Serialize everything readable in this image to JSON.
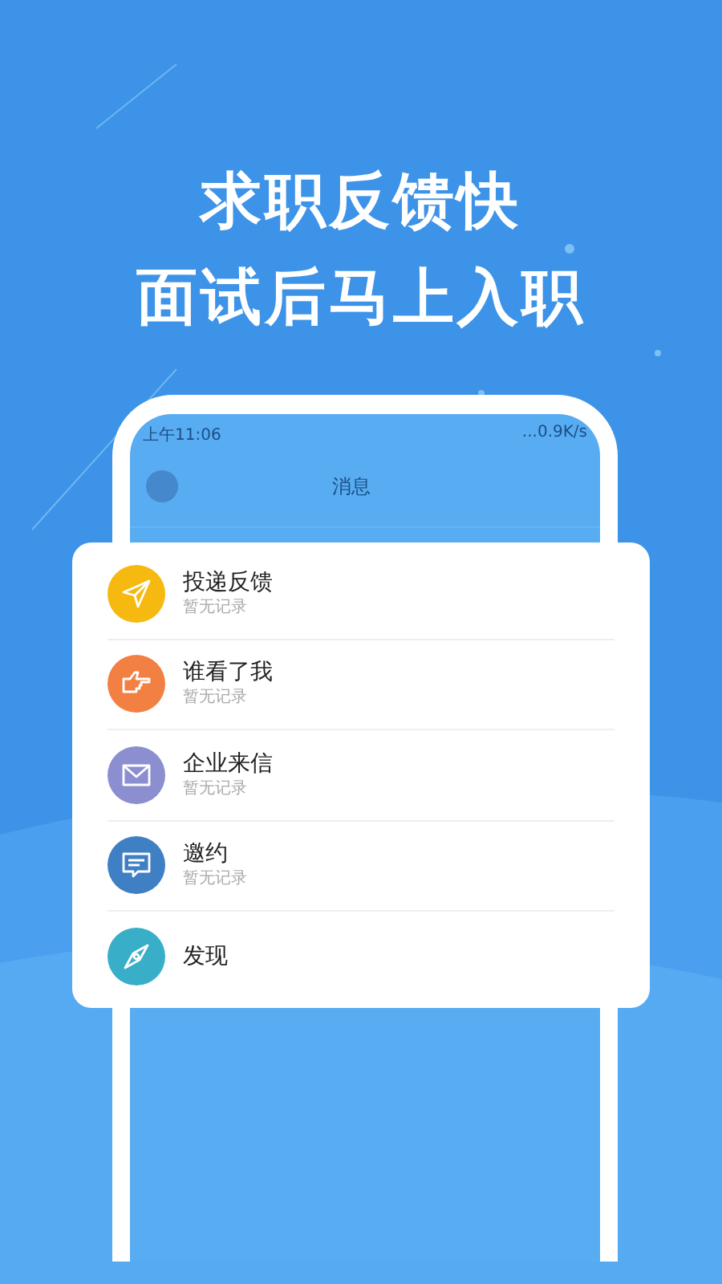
{
  "headline": [
    "求职反馈快",
    "面试后马上入职"
  ],
  "phone": {
    "status_bar": {
      "time": "上午11:06",
      "speed": "...0.9K/s"
    },
    "title": "消息"
  },
  "items": [
    {
      "kind": "send",
      "title": "投递反馈",
      "subtitle": "暂无记录",
      "color": "#f5b90f"
    },
    {
      "kind": "pointer",
      "title": "谁看了我",
      "subtitle": "暂无记录",
      "color": "#f28043"
    },
    {
      "kind": "mail",
      "title": "企业来信",
      "subtitle": "暂无记录",
      "color": "#8b8fd0"
    },
    {
      "kind": "chat",
      "title": "邀约",
      "subtitle": "暂无记录",
      "color": "#3f7fc4"
    },
    {
      "kind": "compass",
      "title": "发现",
      "color": "#39aec8"
    }
  ]
}
